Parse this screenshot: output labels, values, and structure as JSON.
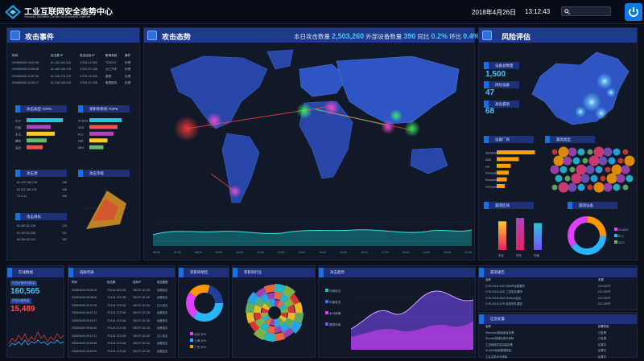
{
  "header": {
    "title": "工业互联网安全态势中心",
    "subtitle": "Security Situation Center for Industrial Internet",
    "date": "2018年4月26日",
    "time": "13:12:43"
  },
  "attack_events": {
    "title": "攻击事件",
    "columns": [
      "时间",
      "攻击源 IP",
      "攻击目标 IP",
      "影响系统",
      "操作"
    ],
    "rows": [
      [
        "2018/04/26 13:02:06",
        "61.161.134.116",
        "17011.10.200",
        "TZ&G37",
        "处理"
      ],
      [
        "2018/04/26 12:59:48",
        "61.160.139.178",
        "17011.97.155",
        "仙三汽车",
        "处理"
      ],
      [
        "2018/04/26 12:57:34",
        "61.126.175.175",
        "17011.10.200",
        "管理",
        "处理"
      ],
      [
        "2018/04/26 12:53:17",
        "61.126.139.219",
        "17011.97.155",
        "管理服务",
        "处理"
      ]
    ],
    "attack_type_label": "攻击类型 TOP5",
    "attack_type_items": [
      "DoS",
      "扫描",
      "木马",
      "蠕虫",
      "溢出"
    ],
    "attack_type_values": [
      0.9,
      0.6,
      0.7,
      0.5,
      0.4
    ],
    "affected_label": "受影响系统 TOP5",
    "affected_items": [
      "SCADA",
      "DCS",
      "PLC",
      "HMI",
      "MES"
    ],
    "affected_values": [
      0.8,
      0.7,
      0.6,
      0.45,
      0.35
    ],
    "source_label": "攻击源",
    "source_rows": [
      [
        "61.123.186.178",
        "198"
      ],
      [
        "61.111.186.176",
        "168"
      ],
      [
        "71.2.14",
        "166"
      ]
    ],
    "level_label": "攻击等级",
    "target_label": "攻击目标",
    "target_rows": [
      [
        "61.287.81.126",
        "176"
      ],
      [
        "61.197.51.235",
        "157"
      ],
      [
        "62.281.52.131",
        "162"
      ]
    ]
  },
  "attack_situation": {
    "title": "攻击态势",
    "stats_label1": "本日攻击数量",
    "stats_value1": "2,503,260",
    "stats_label2": "外部设备数量",
    "stats_value2": "390",
    "stats_label3": "同比",
    "stats_value3": "0.2%",
    "stats_label4": "环比",
    "stats_value4": "0.4%",
    "timeline_ticks": [
      "06:00",
      "07:00",
      "08:00",
      "09:00",
      "10:00",
      "11:00",
      "12:00",
      "13:00",
      "14:00",
      "15:00",
      "16:00",
      "17:00",
      "18:00",
      "19:00",
      "20:00",
      "21:00"
    ]
  },
  "risk": {
    "title": "风险评估",
    "label1": "设备总数量",
    "value1": "1,500",
    "label2": "风险设备",
    "value2": "47",
    "label3": "高危漏洞",
    "value3": "68",
    "vendor_label": "设备厂商",
    "vendor_items": [
      "SIEMENS",
      "ABB",
      "GE",
      "Schneider",
      "Rockwell",
      "Honeywell"
    ],
    "vendor_values": [
      0.95,
      0.55,
      0.35,
      0.3,
      0.25,
      0.2
    ],
    "vuln_type_label": "漏洞类型",
    "vuln_region_label": "漏洞区域",
    "vuln_device_label": "漏洞设备",
    "region_bars": [
      0.85,
      0.95,
      0.8
    ],
    "region_x": [
      "华北",
      "华东",
      "华南"
    ],
    "legend": [
      "SCADA",
      "PLC",
      "DCS"
    ],
    "legend_colors": [
      "#e040fb",
      "#29b6f6",
      "#66bb6a"
    ]
  },
  "bottom": {
    "online_label": "在线数据",
    "online_l1": "在线设备联网数量",
    "online_v1": "160,565",
    "online_l2": "在线设备数量",
    "online_v2": "15,489",
    "threat_label": "威胁列表",
    "threat_cols": [
      "时间",
      "攻击源",
      "目标IP",
      "攻击类型"
    ],
    "threat_rows": [
      [
        "2018/04/26 09:08:23",
        "79.124.152.160",
        "180.97.10.131",
        "远程攻击"
      ],
      [
        "2018/04/26 09:08:26",
        "78.124.172.180",
        "180.97.10.131",
        "远程攻击"
      ],
      [
        "2018/04/26 09:10:45",
        "79.124.172.160",
        "180.97.10.131",
        "注入攻击"
      ],
      [
        "2018/04/26 09:12:13",
        "79.124.172.160",
        "180.97.10.131",
        "远程攻击"
      ],
      [
        "2018/04/26 09:14:37",
        "79.124.172.160",
        "180.97.10.131",
        "远程攻击"
      ],
      [
        "2018/04/26 09:15:48",
        "79.124.172.160",
        "180.97.10.131",
        "远程攻击"
      ],
      [
        "2018/04/26 09:17:21",
        "79.124.172.160",
        "180.97.10.131",
        "注入攻击"
      ],
      [
        "2018/04/26 09:18:58",
        "79.124.172.160",
        "180.97.10.131",
        "远程攻击"
      ],
      [
        "2018/04/26 09:20:34",
        "79.124.172.160",
        "180.97.10.131",
        "远程攻击"
      ]
    ],
    "region_label": "受影响地区",
    "region_legend": [
      "北京 35%",
      "上海 25%",
      "广东 20%"
    ],
    "industry_label": "受影响行业",
    "trend_label": "攻击趋势",
    "trend_legend": [
      "外部攻击",
      "内部攻击",
      "木马病毒",
      "漏洞利用"
    ],
    "notice_label": "漏洞通告",
    "notice_cols": [
      "名称",
      "来源"
    ],
    "notice_rows": [
      [
        "CVE-2018-0142 SNMP远程漏洞",
        "ICS-CERT"
      ],
      [
        "CVE-2018-0152 工控协议漏洞",
        "ICS-CERT"
      ],
      [
        "CVE-2018-0163 Modbus溢出",
        "ICS-CERT"
      ],
      [
        "CVE-2018-0176 组态软件漏洞",
        "ICS-CERT"
      ]
    ],
    "response_label": "应急处置",
    "response_cols": [
      "名称",
      "处置状态"
    ],
    "response_rows": [
      [
        "Wannacry勒索病毒处置",
        "已处置"
      ],
      [
        "Stuxnet变种检测与清除",
        "已处置"
      ],
      [
        "工控网络异常流量处置",
        "处置中"
      ],
      [
        "SCADA系统漏洞修复",
        "处置中"
      ],
      [
        "工业主机木马清除",
        "处置中"
      ]
    ]
  }
}
